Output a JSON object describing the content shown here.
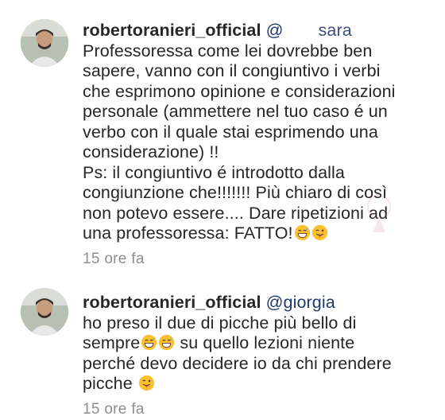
{
  "comments": [
    {
      "username": "robertoranieri_official",
      "mention": "@",
      "mention_name": "sara",
      "lines": [
        "Professoressa come lei dovrebbe ben",
        "sapere, vanno con il congiuntivo i verbi",
        "che esprimono opinione e considerazioni",
        "personale (ammettere nel tuo caso é un",
        "verbo con il quale stai esprimendo una",
        "considerazione) !!",
        "Ps: il congiuntivo é introdotto dalla",
        "congiunzione che!!!!!!! Più chiaro di così",
        "non potevo essere.... Dare ripetizioni ad",
        "una professoressa: FATTO!"
      ],
      "emojis": [
        "grinning-sweat-emoji",
        "winking-tongue-emoji"
      ],
      "timestamp": "15 ore fa"
    },
    {
      "username": "robertoranieri_official",
      "mention": "@giorgia",
      "lines_before_emoji": "ho preso il due di picche più bello di",
      "line2": "sempre",
      "line2_after": " su quello lezioni niente",
      "line3": "perché devo decidere io da chi prendere",
      "line4": "picche ",
      "emojis_line2": [
        "grinning-sweat-emoji",
        "grinning-sweat-emoji"
      ],
      "emojis_line4": [
        "winking-tongue-emoji"
      ],
      "timestamp": "15 ore fa"
    }
  ],
  "colors": {
    "text": "#262626",
    "username": "#262626",
    "mention": "#1f3b6e",
    "timestamp": "#8e8e8e",
    "emoji_face": "#fbc02d"
  }
}
